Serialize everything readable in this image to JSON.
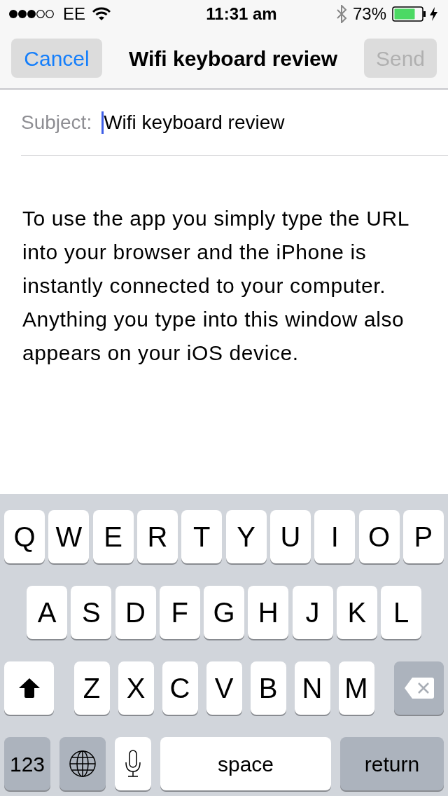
{
  "status_bar": {
    "carrier": "EE",
    "time": "11:31 am",
    "battery": "73%"
  },
  "nav_bar": {
    "cancel": {
      "label": "Cancel",
      "disabled": false
    },
    "title": "Wifi keyboard review",
    "send": {
      "label": "Send",
      "disabled": true
    }
  },
  "subject": {
    "label": "Subject:",
    "value": "Wifi keyboard review"
  },
  "body": "To use the app you simply type the URL into your browser and the iPhone is instantly connected to your computer. Anything you type into this window also appears on your iOS device.",
  "keyboard": {
    "letter_rows": [
      [
        {
          "kind": "letter",
          "label": "Q"
        },
        {
          "kind": "letter",
          "label": "W"
        },
        {
          "kind": "letter",
          "label": "E"
        },
        {
          "kind": "letter",
          "label": "R"
        },
        {
          "kind": "letter",
          "label": "T"
        },
        {
          "kind": "letter",
          "label": "Y"
        },
        {
          "kind": "letter",
          "label": "U"
        },
        {
          "kind": "letter",
          "label": "I"
        },
        {
          "kind": "letter",
          "label": "O"
        },
        {
          "kind": "letter",
          "label": "P"
        }
      ],
      [
        {
          "kind": "letter",
          "label": "A"
        },
        {
          "kind": "letter",
          "label": "S"
        },
        {
          "kind": "letter",
          "label": "D"
        },
        {
          "kind": "letter",
          "label": "F"
        },
        {
          "kind": "letter",
          "label": "G"
        },
        {
          "kind": "letter",
          "label": "H"
        },
        {
          "kind": "letter",
          "label": "J"
        },
        {
          "kind": "letter",
          "label": "K"
        },
        {
          "kind": "letter",
          "label": "L"
        }
      ],
      [
        {
          "kind": "shift"
        },
        {
          "kind": "letter",
          "label": "Z"
        },
        {
          "kind": "letter",
          "label": "X"
        },
        {
          "kind": "letter",
          "label": "C"
        },
        {
          "kind": "letter",
          "label": "V"
        },
        {
          "kind": "letter",
          "label": "B"
        },
        {
          "kind": "letter",
          "label": "N"
        },
        {
          "kind": "letter",
          "label": "M"
        },
        {
          "kind": "delete"
        }
      ]
    ],
    "bottom_row": [
      {
        "kind": "numbers",
        "label": "123"
      },
      {
        "kind": "globe"
      },
      {
        "kind": "mic"
      },
      {
        "kind": "space",
        "label": "space"
      },
      {
        "kind": "return",
        "label": "return"
      }
    ]
  }
}
